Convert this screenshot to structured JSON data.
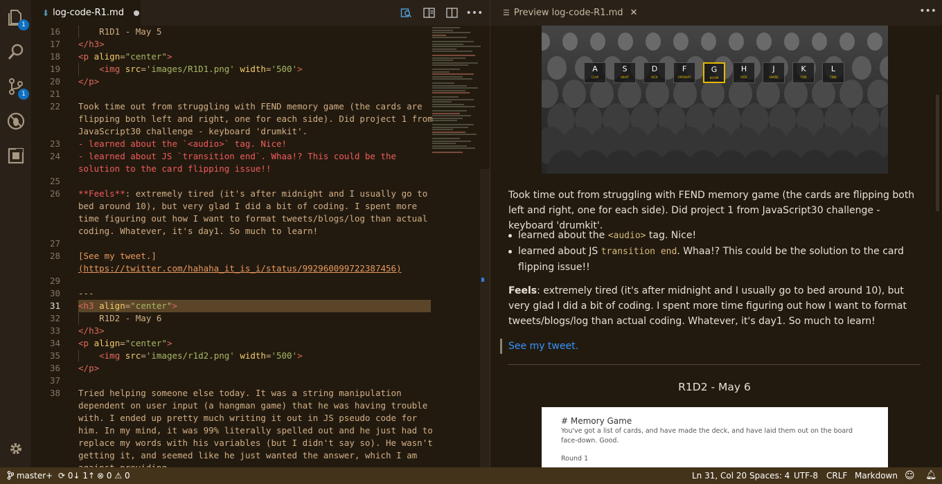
{
  "activity": {
    "explorer_badge": "1",
    "scm_badge": "1"
  },
  "editor": {
    "tab_title": "log-code-R1.md",
    "lines": [
      {
        "n": "16",
        "parts": [
          [
            "    R1D1 - May 5",
            ""
          ]
        ],
        "guide": true
      },
      {
        "n": "17",
        "parts": [
          [
            "</",
            "tag"
          ],
          [
            "h3",
            "tag"
          ],
          [
            ">",
            "tag"
          ]
        ]
      },
      {
        "n": "18",
        "parts": [
          [
            "<",
            "tag"
          ],
          [
            "p ",
            "tag"
          ],
          [
            "align",
            "attr"
          ],
          [
            "=",
            ""
          ],
          [
            "\"center\"",
            "str"
          ],
          [
            ">",
            "tag"
          ]
        ]
      },
      {
        "n": "19",
        "parts": [
          [
            "    <",
            "tag"
          ],
          [
            "img ",
            "tag"
          ],
          [
            "src",
            "attr"
          ],
          [
            "=",
            ""
          ],
          [
            "'images/R1D1.png'",
            "str"
          ],
          [
            " width",
            "attr"
          ],
          [
            "=",
            ""
          ],
          [
            "'500'",
            "str"
          ],
          [
            ">",
            "tag"
          ]
        ],
        "guide": true
      },
      {
        "n": "20",
        "parts": [
          [
            "</",
            "tag"
          ],
          [
            "p",
            "tag"
          ],
          [
            ">",
            "tag"
          ]
        ]
      },
      {
        "n": "21",
        "parts": []
      },
      {
        "n": "22",
        "parts": [
          [
            "Took time out from struggling with FEND memory game (the cards are",
            ""
          ]
        ]
      },
      {
        "n": "",
        "parts": [
          [
            "flipping both left and right, one for each side). Did project 1 from",
            ""
          ]
        ]
      },
      {
        "n": "",
        "parts": [
          [
            "JavaScript30 challenge - keyboard 'drumkit'.",
            ""
          ]
        ]
      },
      {
        "n": "23",
        "parts": [
          [
            "- learned about the `<audio>` tag. Nice!",
            "red"
          ]
        ]
      },
      {
        "n": "24",
        "parts": [
          [
            "- learned about JS `transition end`. Whaa!? This could be the",
            "red"
          ]
        ]
      },
      {
        "n": "",
        "parts": [
          [
            "solution to the card flipping issue!!",
            "red"
          ]
        ]
      },
      {
        "n": "25",
        "parts": []
      },
      {
        "n": "26",
        "parts": [
          [
            "**Feels**",
            "red"
          ],
          [
            ": extremely tired (it's after midnight and I usually go to",
            ""
          ]
        ]
      },
      {
        "n": "",
        "parts": [
          [
            "bed around 10), but very glad I did a bit of coding. I spent more",
            ""
          ]
        ]
      },
      {
        "n": "",
        "parts": [
          [
            "time figuring out how I want to format tweets/blogs/log than actual",
            ""
          ]
        ]
      },
      {
        "n": "",
        "parts": [
          [
            "coding. Whatever, it's day1. So much to learn!",
            ""
          ]
        ]
      },
      {
        "n": "27",
        "parts": []
      },
      {
        "n": "28",
        "parts": [
          [
            "[See my tweet.]",
            "link"
          ]
        ]
      },
      {
        "n": "",
        "parts": [
          [
            "(https://twitter.com/hahaha_it_is_i/status/992960099722387456)",
            "link"
          ]
        ]
      },
      {
        "n": "29",
        "parts": []
      },
      {
        "n": "30",
        "parts": [
          [
            "---",
            ""
          ]
        ]
      },
      {
        "n": "31",
        "parts": [
          [
            "<",
            "tag"
          ],
          [
            "h3 ",
            "tag"
          ],
          [
            "align",
            "attr"
          ],
          [
            "=",
            ""
          ],
          [
            "\"center\"",
            "str"
          ],
          [
            ">",
            "tag"
          ]
        ],
        "cur": true
      },
      {
        "n": "32",
        "parts": [
          [
            "    R1D2 - May 6",
            ""
          ]
        ],
        "guide": true
      },
      {
        "n": "33",
        "parts": [
          [
            "</",
            "tag"
          ],
          [
            "h3",
            "tag"
          ],
          [
            ">",
            "tag"
          ]
        ]
      },
      {
        "n": "34",
        "parts": [
          [
            "<",
            "tag"
          ],
          [
            "p ",
            "tag"
          ],
          [
            "align",
            "attr"
          ],
          [
            "=",
            ""
          ],
          [
            "\"center\"",
            "str"
          ],
          [
            ">",
            "tag"
          ]
        ]
      },
      {
        "n": "35",
        "parts": [
          [
            "    <",
            "tag"
          ],
          [
            "img ",
            "tag"
          ],
          [
            "src",
            "attr"
          ],
          [
            "=",
            ""
          ],
          [
            "'images/r1d2.png'",
            "str"
          ],
          [
            " width",
            "attr"
          ],
          [
            "=",
            ""
          ],
          [
            "'500'",
            "str"
          ],
          [
            ">",
            "tag"
          ]
        ],
        "guide": true
      },
      {
        "n": "36",
        "parts": [
          [
            "</",
            "tag"
          ],
          [
            "p",
            "tag"
          ],
          [
            ">",
            "tag"
          ]
        ]
      },
      {
        "n": "37",
        "parts": []
      },
      {
        "n": "38",
        "parts": [
          [
            "Tried helping someone else today. It was a string manipulation",
            ""
          ]
        ]
      },
      {
        "n": "",
        "parts": [
          [
            "dependent on user input (a hangman game) that he was having trouble",
            ""
          ]
        ]
      },
      {
        "n": "",
        "parts": [
          [
            "with. I ended up pretty much writing it out in JS pseudo code for",
            ""
          ]
        ]
      },
      {
        "n": "",
        "parts": [
          [
            "him. In my mind, it was 99% literally spelled out and he just had to",
            ""
          ]
        ]
      },
      {
        "n": "",
        "parts": [
          [
            "replace my words with his variables (but I didn't say so). He wasn't",
            ""
          ]
        ]
      },
      {
        "n": "",
        "parts": [
          [
            "getting it, and seemed like he just wanted the answer, which I am",
            ""
          ]
        ]
      },
      {
        "n": "",
        "parts": [
          [
            "against providing.",
            ""
          ]
        ]
      }
    ]
  },
  "preview": {
    "tab_title": "Preview log-code-R1.md",
    "keys": [
      [
        "A",
        "CLAP"
      ],
      [
        "S",
        "HIHAT"
      ],
      [
        "D",
        "KICK"
      ],
      [
        "F",
        "OPENHAT"
      ],
      [
        "G",
        "BOOM"
      ],
      [
        "H",
        "RIDE"
      ],
      [
        "J",
        "SNARE"
      ],
      [
        "K",
        "TOM"
      ],
      [
        "L",
        "TINK"
      ]
    ],
    "para1": "Took time out from struggling with FEND memory game (the cards are flipping both left and right, one for each side). Did project 1 from JavaScript30 challenge - keyboard 'drumkit'.",
    "li1_a": "learned about the ",
    "li1_code": "<audio>",
    "li1_b": " tag. Nice!",
    "li2_a": "learned about JS ",
    "li2_code": "transition end",
    "li2_b": ". Whaa!? This could be the solution to the card flipping issue!!",
    "feels_bold": "Feels",
    "feels_text": ": extremely tired (it's after midnight and I usually go to bed around 10), but very glad I did a bit of coding. I spent more time figuring out how I want to format tweets/blogs/log than actual coding. Whatever, it's day1. So much to learn!",
    "tweet_link": "See my tweet.",
    "heading2": "R1D2 - May 6",
    "card_title": "# Memory Game",
    "card_text": "You've got a list of cards, and have made the deck, and have laid them out on the board face-down. Good.",
    "card_round": "Round 1"
  },
  "status": {
    "branch": "master+",
    "sync": "0↓ 1↑",
    "errors": "0",
    "warnings": "0",
    "position": "Ln 31, Col 20",
    "spaces": "Spaces: 4",
    "encoding": "UTF-8",
    "eol": "CRLF",
    "language": "Markdown"
  },
  "colors": {
    "status_bg": "#43331a",
    "editor_bg": "#221a0f",
    "accent_badge": "#0e70c0"
  }
}
